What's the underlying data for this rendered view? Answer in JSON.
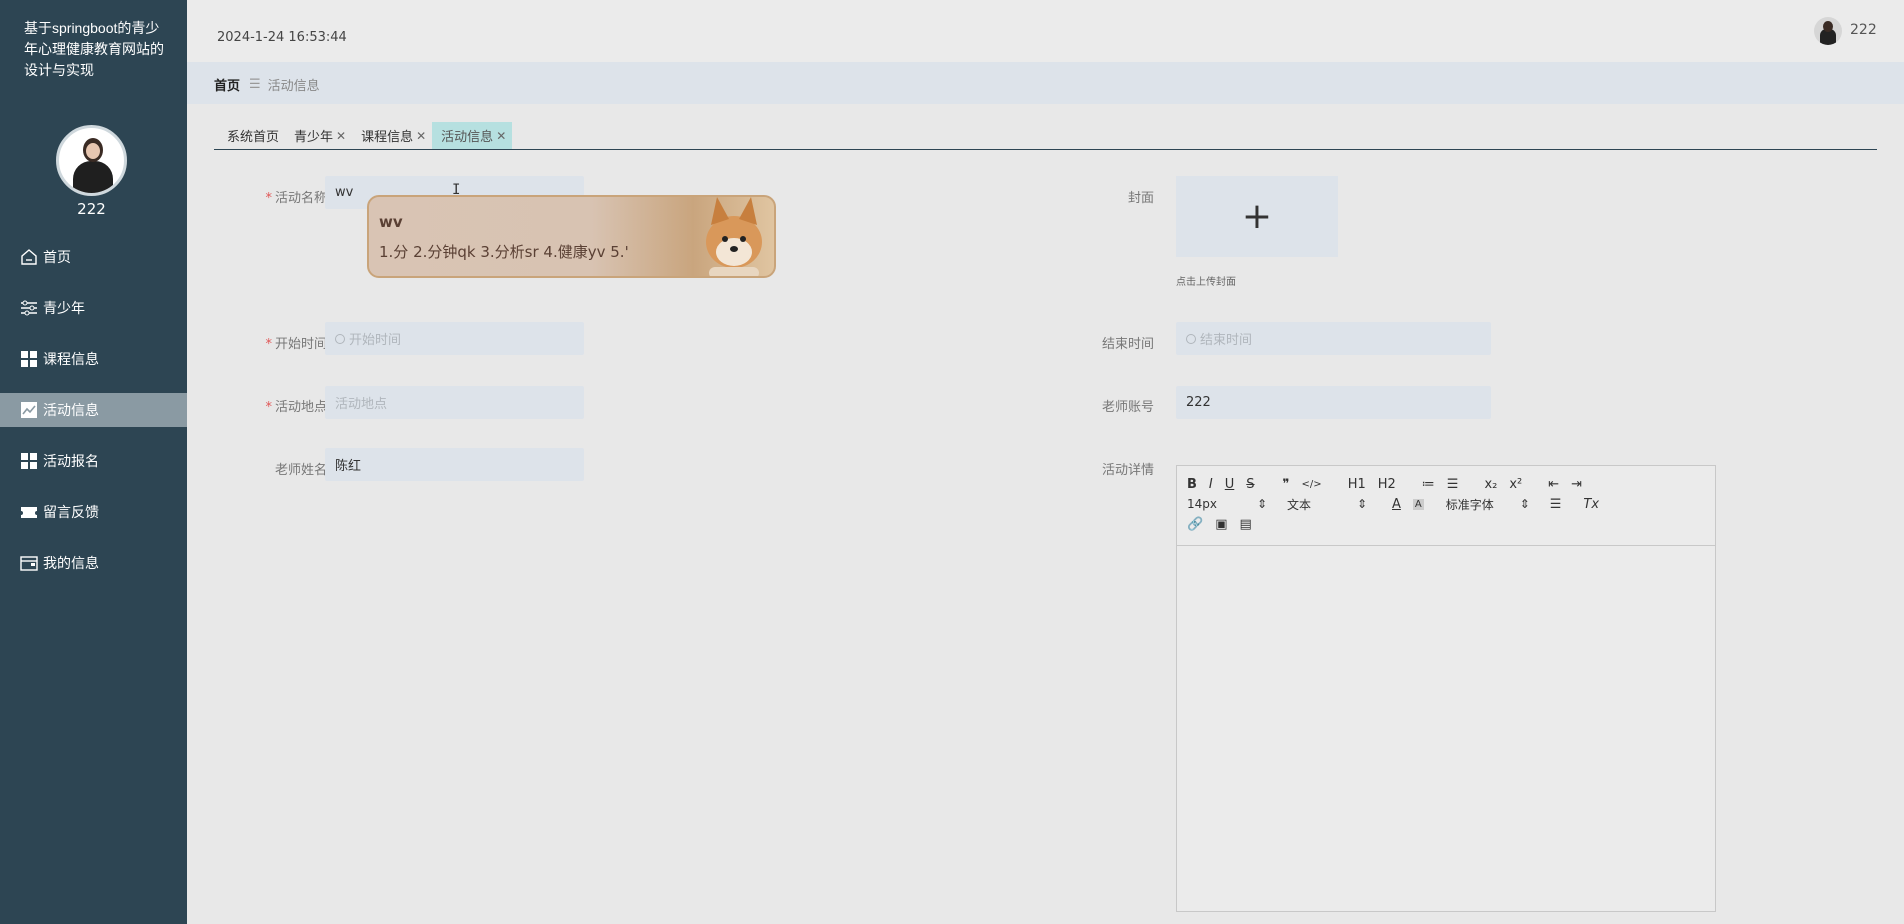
{
  "sidebar": {
    "site_title": "基于springboot的青少年心理健康教育网站的设计与实现",
    "username": "222",
    "items": [
      {
        "label": "首页",
        "icon": "home-icon"
      },
      {
        "label": "青少年",
        "icon": "sliders-icon"
      },
      {
        "label": "课程信息",
        "icon": "grid-icon"
      },
      {
        "label": "活动信息",
        "icon": "chart-icon"
      },
      {
        "label": "活动报名",
        "icon": "grid-icon"
      },
      {
        "label": "留言反馈",
        "icon": "ticket-icon"
      },
      {
        "label": "我的信息",
        "icon": "wallet-icon"
      }
    ],
    "active_index": 3
  },
  "header": {
    "datetime": "2024-1-24 16:53:44",
    "username": "222"
  },
  "breadcrumb": {
    "home": "首页",
    "current": "活动信息"
  },
  "tabs": [
    {
      "label": "系统首页",
      "closable": false
    },
    {
      "label": "青少年",
      "closable": true
    },
    {
      "label": "课程信息",
      "closable": true
    },
    {
      "label": "活动信息",
      "closable": true
    }
  ],
  "form": {
    "name_label": "活动名称",
    "name_value": "wv",
    "start_label": "开始时间",
    "start_placeholder": "开始时间",
    "place_label": "活动地点",
    "place_placeholder": "活动地点",
    "teacher_name_label": "老师姓名",
    "teacher_name_value": "陈红",
    "cover_label": "封面",
    "cover_hint": "点击上传封面",
    "end_label": "结束时间",
    "end_placeholder": "结束时间",
    "teacher_account_label": "老师账号",
    "teacher_account_value": "222",
    "detail_label": "活动详情"
  },
  "ime": {
    "typed": "wv",
    "candidates": "1.分  2.分钟qk  3.分析sr  4.健康yv  5.'"
  },
  "editor": {
    "font_size": "14px",
    "paragraph": "文本",
    "font_family": "标准字体",
    "buttons_row1": [
      "B",
      "I",
      "U",
      "S",
      "❞",
      "</>",
      "H1",
      "H2",
      "≔",
      "☰",
      "x₂",
      "x²",
      "⇤",
      "⇥"
    ]
  },
  "colors": {
    "sidebar_bg": "#2d4553",
    "active_tab": "#b6e0e0",
    "required": "#e05555"
  }
}
